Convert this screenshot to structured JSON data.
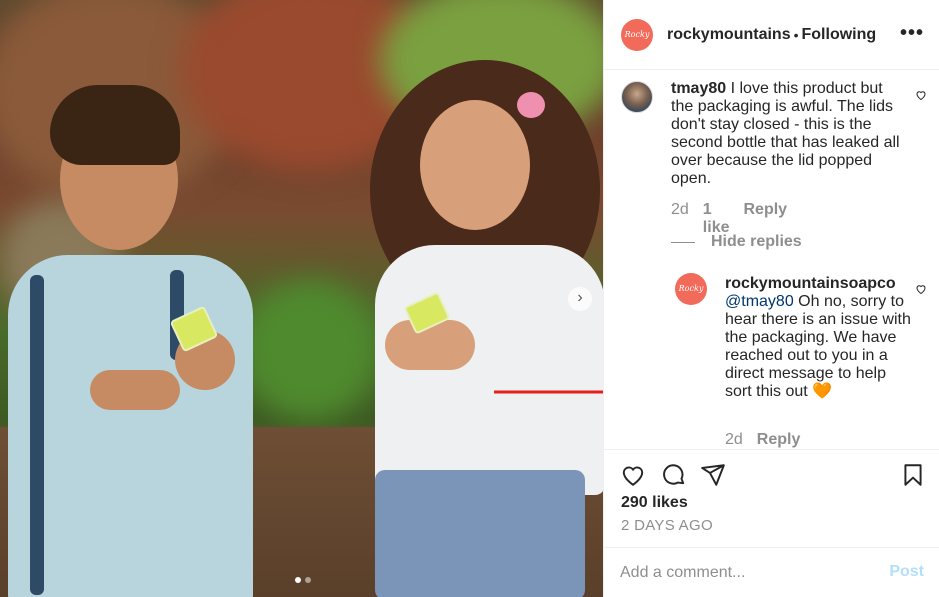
{
  "post": {
    "account": "rockymountains",
    "separator": "•",
    "follow_status": "Following",
    "more_label": "•••",
    "logo_text": "Rocky"
  },
  "comments": [
    {
      "user": "tmay80",
      "text": "I love this product but the packaging is awful. The lids don't stay closed - this is the second bottle that has leaked all over because the lid popped open.",
      "time": "2d",
      "likes": "1 like",
      "reply": "Reply"
    }
  ],
  "hide_replies": "Hide replies",
  "reply": {
    "user": "rockymountainsoapco",
    "mention": "@tmay80",
    "text": "Oh no, sorry to hear there is an issue with the packaging. We have reached out to you in a direct message to help sort this out",
    "emoji": "🧡",
    "time": "2d",
    "reply_label": "Reply"
  },
  "stats": {
    "likes": "290 likes",
    "posted": "2 DAYS AGO"
  },
  "composer": {
    "placeholder": "Add a comment...",
    "post_label": "Post"
  },
  "colors": {
    "brand_logo": "#f26a5a",
    "post_button_disabled": "#b2dffc",
    "annotation_arrow": "#e8201a"
  },
  "icons": [
    "heart-icon",
    "comment-icon",
    "share-icon",
    "bookmark-icon",
    "chevron-right-icon"
  ]
}
